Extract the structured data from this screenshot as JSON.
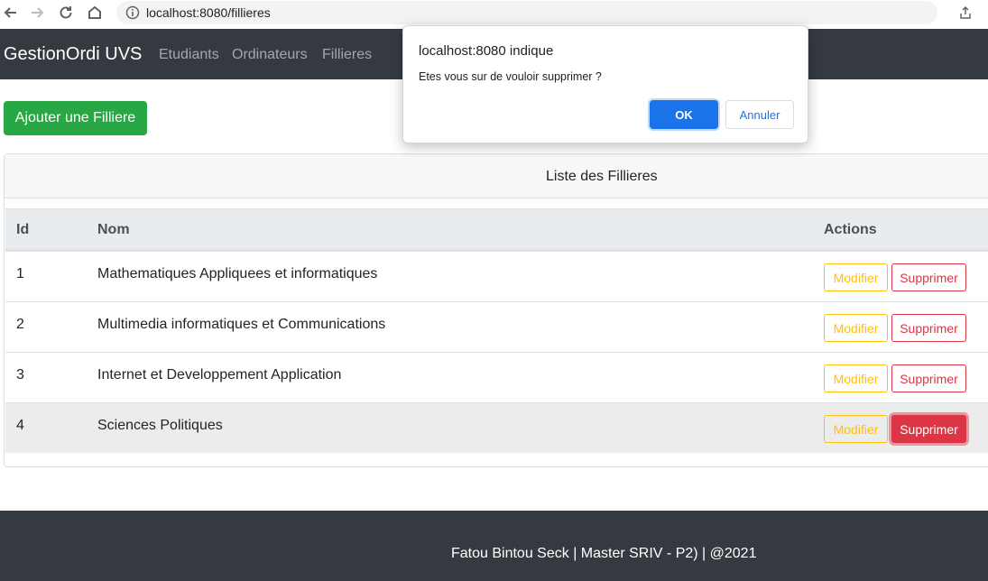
{
  "browser": {
    "url": "localhost:8080/fillieres"
  },
  "navbar": {
    "brand": "GestionOrdi UVS",
    "links": [
      "Etudiants",
      "Ordinateurs",
      "Fillieres"
    ]
  },
  "actions": {
    "add_label": "Ajouter une Filliere"
  },
  "card": {
    "header": "Liste des Fillieres",
    "columns": [
      "Id",
      "Nom",
      "Actions"
    ],
    "rows": [
      {
        "id": "1",
        "nom": "Mathematiques Appliquees et informatiques",
        "modify": "Modifier",
        "delete": "Supprimer"
      },
      {
        "id": "2",
        "nom": "Multimedia informatiques et Communications",
        "modify": "Modifier",
        "delete": "Supprimer"
      },
      {
        "id": "3",
        "nom": "Internet et Developpement Application",
        "modify": "Modifier",
        "delete": "Supprimer"
      },
      {
        "id": "4",
        "nom": "Sciences Politiques",
        "modify": "Modifier",
        "delete": "Supprimer"
      }
    ]
  },
  "footer": {
    "text": "Fatou Bintou Seck | Master SRIV - P2) | @2021"
  },
  "dialog": {
    "title": "localhost:8080 indique",
    "message": "Etes vous sur de vouloir supprimer ?",
    "ok": "OK",
    "cancel": "Annuler"
  },
  "colors": {
    "navbar": "#343a40",
    "success": "#28a745",
    "warning": "#ffc107",
    "danger": "#dc3545",
    "dialog_primary": "#1a73e8"
  },
  "icons": [
    "back-arrow-icon",
    "forward-arrow-icon",
    "reload-icon",
    "home-icon",
    "info-icon",
    "share-icon"
  ]
}
